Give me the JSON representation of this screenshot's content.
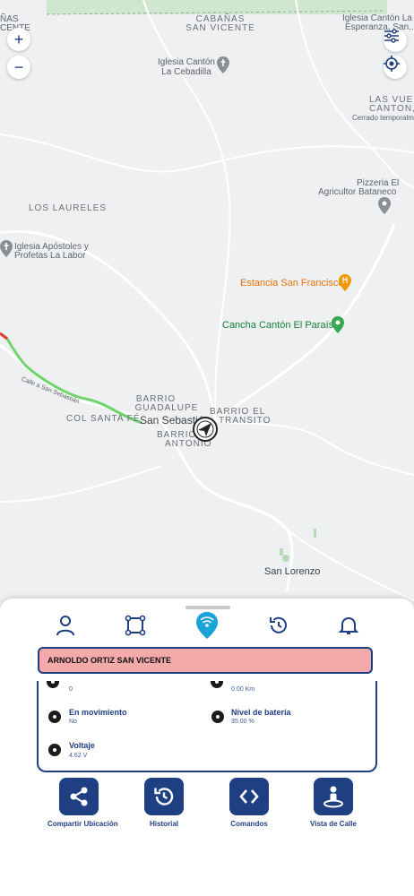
{
  "map": {
    "labels": {
      "canas": "ÑAS",
      "cente": "CENTE",
      "cabanas": "CABAÑAS",
      "san_vicente_area": "SAN VICENTE",
      "iglesia_esperanza_1": "Iglesia Cantón La",
      "iglesia_esperanza_2": "Esperanza, San...",
      "iglesia_cebadilla_1": "Iglesia Cantón",
      "iglesia_cebadilla_2": "La Cebadilla",
      "las_vueltas_1": "LAS VUELT",
      "las_vueltas_2": "CANTON, I",
      "las_vueltas_3": "Cerrado temporalm",
      "pizzeria_1": "Pizzeria El",
      "pizzeria_2": "Agricultor Bataneco",
      "los_laureles": "LOS LAURELES",
      "iglesia_apostoles_1": "Iglesia Apóstoles y",
      "iglesia_apostoles_2": "Profetas La Labor",
      "estancia": "Estancia San Francisco",
      "cancha": "Cancha Cantón El Paraíso",
      "calle_san_sebastian": "Calle a San Sebastián",
      "barrio_guadalupe_1": "BARRIO",
      "barrio_guadalupe_2": "GUADALUPE",
      "barrio_transito_1": "BARRIO EL",
      "barrio_transito_2": "TRANSITO",
      "col_santa_fe": "COL SANTA FÉ",
      "san_sebastian": "San Sebastián",
      "barrio_antonio_1": "BARRIO",
      "barrio_antonio_2": "ANTONIO",
      "san_lorenzo": "San Lorenzo"
    },
    "controls": {
      "zoom_in": "+",
      "zoom_out": "−"
    }
  },
  "tabs": [
    "person-icon",
    "geofence-icon",
    "live-signal-icon",
    "history-icon",
    "bell-icon"
  ],
  "vehicle": {
    "name": "ARNOLDO ORTIZ SAN VICENTE"
  },
  "details": {
    "partial_left_value": "0",
    "partial_right_value": "0.00 Km",
    "moving_label": "En movimiento",
    "moving_value": "No",
    "battery_label": "Nivel de batería",
    "battery_value": "35.00 %",
    "voltage_label": "Voltaje",
    "voltage_value": "4.62 V"
  },
  "actions": {
    "share": "Compartir Ubicación",
    "history": "Historial",
    "commands": "Comandos",
    "street_view": "Vista de Calle"
  },
  "colors": {
    "accent": "#1f3f83",
    "name_bar": "#f4a9ab",
    "active_tab": "#1aa3d9",
    "route": "#6fd46a",
    "poi_green": "#188038",
    "poi_orange": "#e8710a"
  }
}
